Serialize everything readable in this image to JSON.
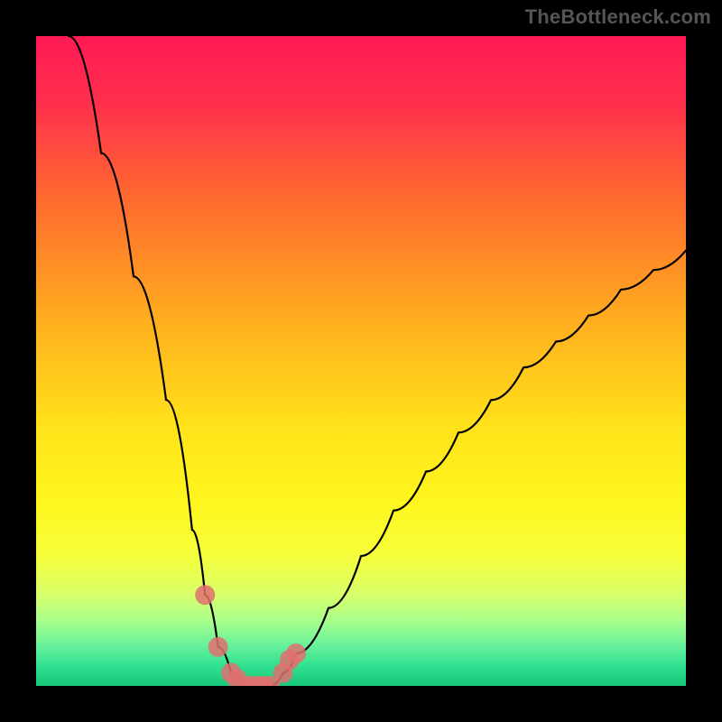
{
  "watermark": "TheBottleneck.com",
  "chart_data": {
    "type": "line",
    "title": "",
    "xlabel": "",
    "ylabel": "",
    "xlim": [
      0,
      100
    ],
    "ylim": [
      0,
      100
    ],
    "series": [
      {
        "name": "bottleneck-curve",
        "x": [
          5,
          10,
          15,
          20,
          24,
          26,
          28,
          30,
          32,
          34,
          36,
          38,
          40,
          45,
          50,
          55,
          60,
          65,
          70,
          75,
          80,
          85,
          90,
          95,
          100
        ],
        "y": [
          100,
          82,
          63,
          44,
          24,
          14,
          6,
          2,
          0,
          0,
          0,
          2,
          5,
          12,
          20,
          27,
          33,
          39,
          44,
          49,
          53,
          57,
          61,
          64,
          67
        ]
      }
    ],
    "markers": {
      "name": "highlighted-points",
      "color": "#e07070",
      "x": [
        26,
        28,
        30,
        31,
        32,
        33,
        34,
        35,
        36,
        38,
        39,
        40
      ],
      "y": [
        14,
        6,
        2,
        1,
        0,
        0,
        0,
        0,
        0,
        2,
        4,
        5
      ]
    },
    "gradient_stops": [
      {
        "offset": 0.0,
        "color": "#ff1a55"
      },
      {
        "offset": 0.1,
        "color": "#ff2e4d"
      },
      {
        "offset": 0.25,
        "color": "#ff6a2f"
      },
      {
        "offset": 0.45,
        "color": "#ffb21e"
      },
      {
        "offset": 0.6,
        "color": "#ffe21a"
      },
      {
        "offset": 0.72,
        "color": "#fff61e"
      },
      {
        "offset": 0.8,
        "color": "#f6ff3c"
      },
      {
        "offset": 0.86,
        "color": "#d8ff6a"
      },
      {
        "offset": 0.9,
        "color": "#a8ff8c"
      },
      {
        "offset": 0.94,
        "color": "#63f09a"
      },
      {
        "offset": 0.97,
        "color": "#2fe090"
      },
      {
        "offset": 1.0,
        "color": "#18c878"
      }
    ]
  }
}
